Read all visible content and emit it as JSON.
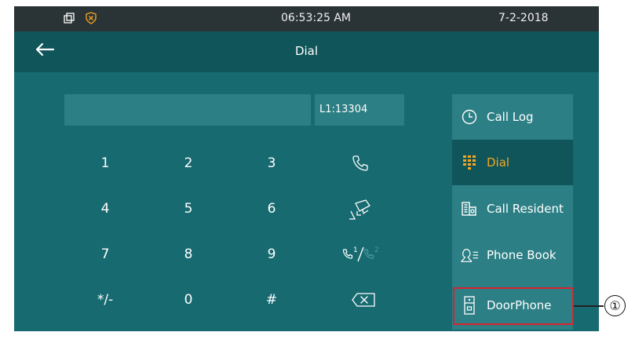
{
  "status_bar": {
    "time": "06:53:25   AM",
    "date": "7-2-2018",
    "icons": [
      "windows-icon",
      "shield-alert-icon"
    ]
  },
  "title_bar": {
    "back_icon": "arrow-left-icon",
    "title": "Dial"
  },
  "dial_input": {
    "value": "",
    "line": "L1:13304"
  },
  "keypad": {
    "keys": [
      "1",
      "2",
      "3",
      "4",
      "5",
      "6",
      "7",
      "8",
      "9",
      "*/-",
      "0",
      "#"
    ],
    "function_icons": [
      "phone-call-icon",
      "video-call-icon",
      "line-switch-icon",
      "backspace-icon"
    ],
    "line_switch_digits": [
      "1",
      "2"
    ]
  },
  "sidebar": {
    "items": [
      {
        "label": "Call Log",
        "icon": "clock-icon",
        "active": false
      },
      {
        "label": "Dial",
        "icon": "keypad-icon",
        "active": true
      },
      {
        "label": "Call Resident",
        "icon": "building-icon",
        "active": false
      },
      {
        "label": "Phone Book",
        "icon": "contacts-icon",
        "active": false
      },
      {
        "label": "DoorPhone",
        "icon": "doorphone-icon",
        "active": false
      }
    ]
  },
  "annotation": {
    "marker": "①"
  },
  "colors": {
    "screen_bg": "#176a70",
    "panel": "#2c7f85",
    "header": "#0f5559",
    "status_bar": "#2a3336",
    "accent": "#f5a623",
    "highlight": "#d9232d"
  }
}
